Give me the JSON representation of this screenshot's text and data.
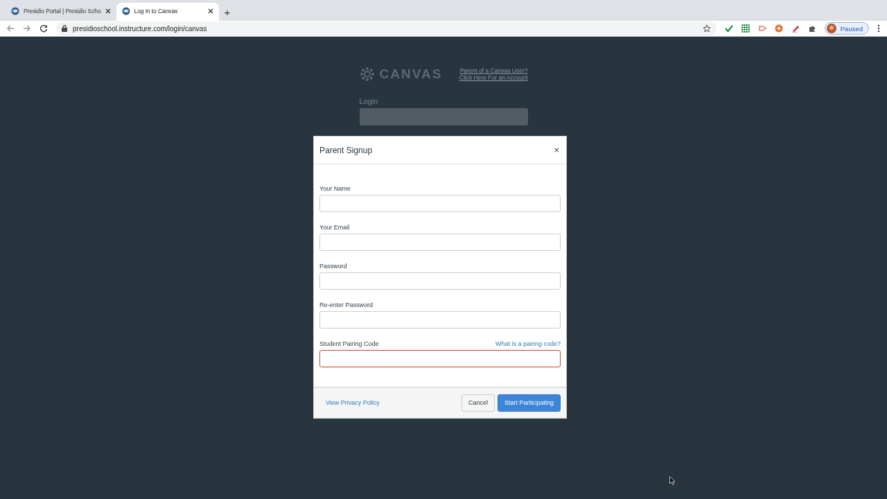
{
  "browser": {
    "tabs": [
      {
        "title": "Presidio Portal | Presidio Scho",
        "selected": false
      },
      {
        "title": "Log In to Canvas",
        "selected": true
      }
    ],
    "new_tab": "+",
    "address": "presidioschool.instructure.com/login/canvas",
    "profile": "Paused"
  },
  "background_page": {
    "logo": "CANVAS",
    "links": [
      "Parent of a Canvas User?",
      "Click Here For an Account"
    ],
    "login_label": "Login"
  },
  "dialog": {
    "title": "Parent Signup",
    "close": "×",
    "fields": [
      {
        "label": "Your Name",
        "invalid": false
      },
      {
        "label": "Your Email",
        "invalid": false
      },
      {
        "label": "Password",
        "invalid": false
      },
      {
        "label": "Re-enter Password",
        "invalid": false
      },
      {
        "label": "Student Pairing Code",
        "invalid": true,
        "help_link": "What is a pairing code?"
      }
    ],
    "privacy_link": "View Privacy Policy",
    "buttons": [
      {
        "label": "Cancel",
        "kind": "secondary"
      },
      {
        "label": "Start Participating",
        "kind": "primary"
      }
    ]
  }
}
